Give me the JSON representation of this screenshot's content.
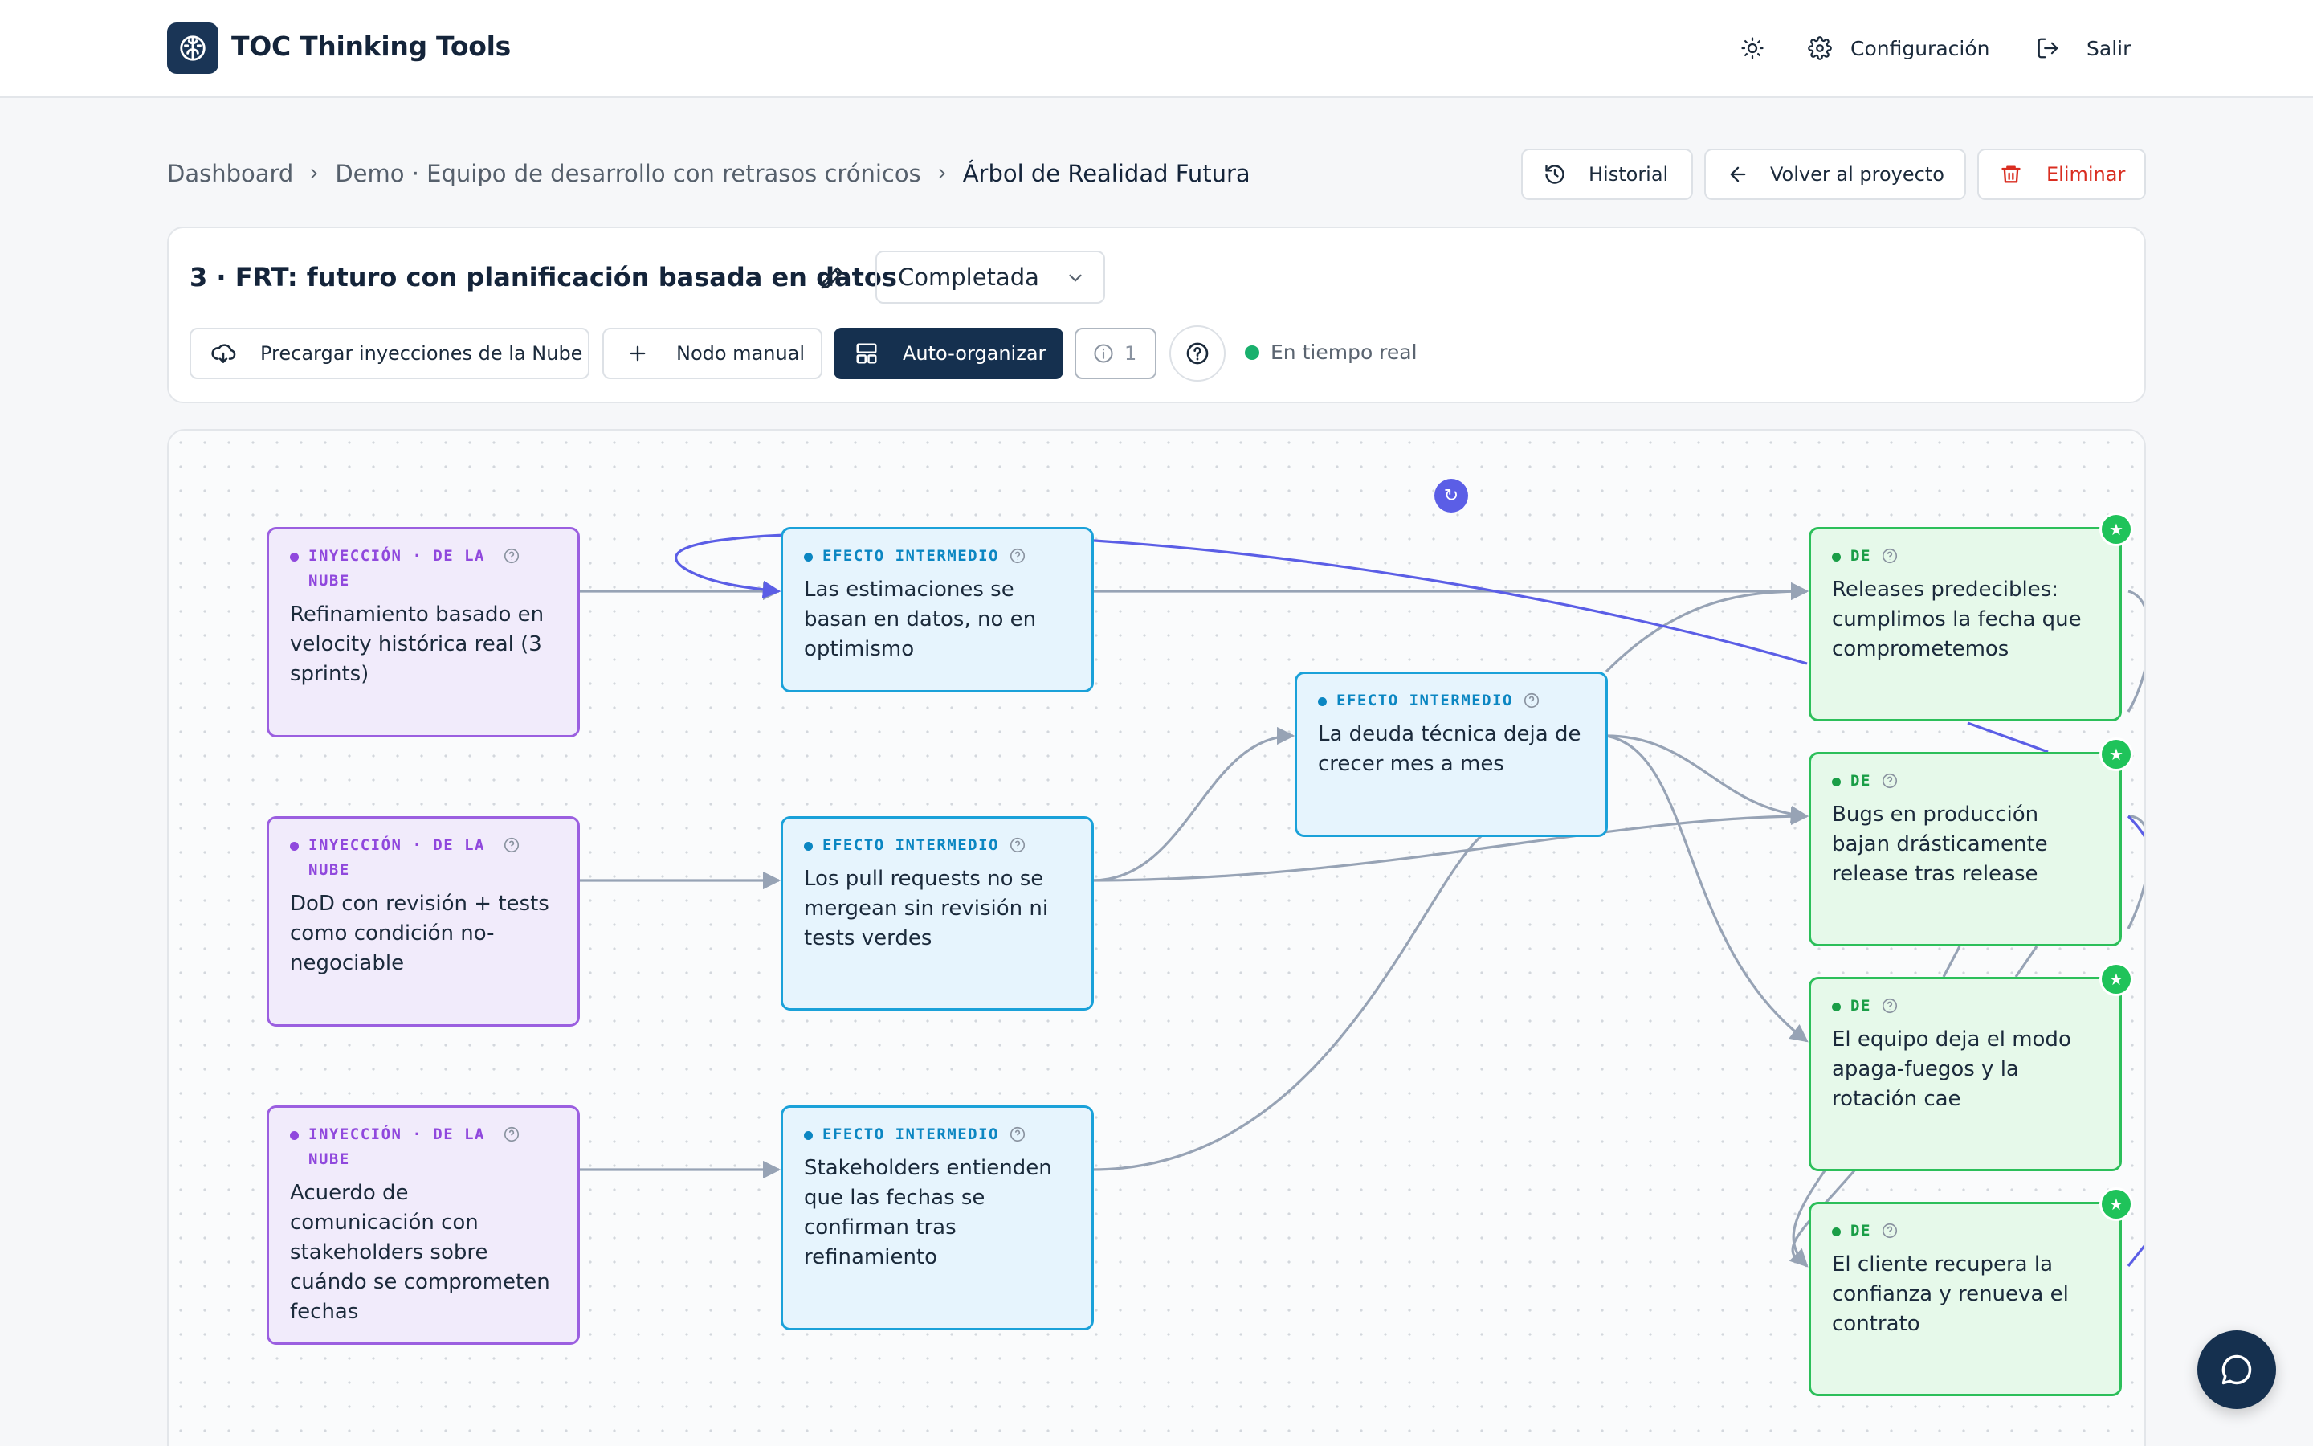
{
  "app": {
    "title": "TOC Thinking Tools"
  },
  "topbar": {
    "settings_label": "Configuración",
    "logout_label": "Salir"
  },
  "breadcrumb": {
    "items": [
      "Dashboard",
      "Demo · Equipo de desarrollo con retrasos crónicos",
      "Árbol de Realidad Futura"
    ]
  },
  "page_actions": {
    "history": "Historial",
    "back": "Volver al proyecto",
    "delete": "Eliminar"
  },
  "analysis": {
    "title": "3 · FRT: futuro con planificación basada en datos",
    "status": "Completada"
  },
  "toolbar": {
    "preload": "Precargar inyecciones de la Nube",
    "manual_node": "Nodo manual",
    "auto_arrange": "Auto-organizar",
    "info_count": "1",
    "realtime": "En tiempo real"
  },
  "nodes": {
    "inj1": {
      "tag": "INYECCIÓN · DE LA NUBE",
      "text": "Refinamiento basado en velocity histórica real (3 sprints)"
    },
    "inj2": {
      "tag": "INYECCIÓN · DE LA NUBE",
      "text": "DoD con revisión + tests como condición no-negociable"
    },
    "inj3": {
      "tag": "INYECCIÓN · DE LA NUBE",
      "text": "Acuerdo de comunicación con stakeholders sobre cuándo se comprometen fechas"
    },
    "ie1": {
      "tag": "EFECTO INTERMEDIO",
      "text": "Las estimaciones se basan en datos, no en optimismo"
    },
    "ie2": {
      "tag": "EFECTO INTERMEDIO",
      "text": "Los pull requests no se mergean sin revisión ni tests verdes"
    },
    "ie3": {
      "tag": "EFECTO INTERMEDIO",
      "text": "Stakeholders entienden que las fechas se confirman tras refinamiento"
    },
    "ie4": {
      "tag": "EFECTO INTERMEDIO",
      "text": "La deuda técnica deja de crecer mes a mes"
    },
    "de1": {
      "tag": "DE",
      "text": "Releases predecibles: cumplimos la fecha que comprometemos"
    },
    "de2": {
      "tag": "DE",
      "text": "Bugs en producción bajan drásticamente release tras release"
    },
    "de3": {
      "tag": "DE",
      "text": "El equipo deja el modo apaga-fuegos y la rotación cae"
    },
    "de4": {
      "tag": "DE",
      "text": "El cliente recupera la confianza y renueva el contrato"
    }
  },
  "colors": {
    "brand": "#15304f",
    "injection": "#9b5fe0",
    "intermediate": "#1aa1d9",
    "desirable": "#2cbf5a",
    "danger": "#d92d20",
    "loop_edge": "#5b5ee6",
    "edge": "#97a3b5"
  },
  "icons": {
    "logo": "brain-icon",
    "theme": "sun-icon",
    "settings": "gear-icon",
    "logout": "logout-icon",
    "history": "history-icon",
    "back": "arrow-left-icon",
    "delete": "trash-icon",
    "edit": "pencil-icon",
    "preload": "cloud-download-icon",
    "manual_node": "plus-icon",
    "auto_arrange": "layout-icon",
    "info": "info-icon",
    "help": "help-icon",
    "chat": "chat-icon"
  }
}
